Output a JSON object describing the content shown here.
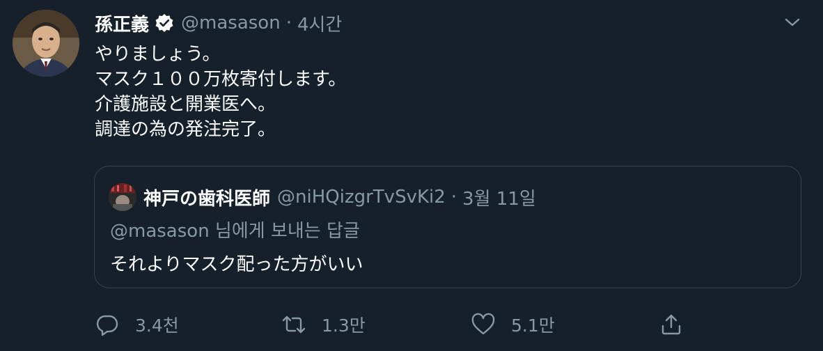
{
  "tweet": {
    "display_name": "孫正義",
    "handle": "@masason",
    "separator": "·",
    "time": "4시간",
    "lines": [
      "やりましょう。",
      "マスク１００万枚寄付します。",
      "介護施設と開業医へ。",
      "調達の為の発注完了。"
    ]
  },
  "quote": {
    "display_name": "神戸の歯科医師",
    "handle": "@niHQizgrTvSvKi2",
    "separator": "·",
    "date": "3월 11일",
    "reply_to": "@masason 님에게 보내는 답글",
    "text": "それよりマスク配った方がいい"
  },
  "actions": {
    "reply_count": "3.4천",
    "retweet_count": "1.3만",
    "like_count": "5.1만"
  },
  "colors": {
    "background": "#15202b",
    "text": "#ffffff",
    "secondary": "#8899a6",
    "border": "#38444d"
  }
}
